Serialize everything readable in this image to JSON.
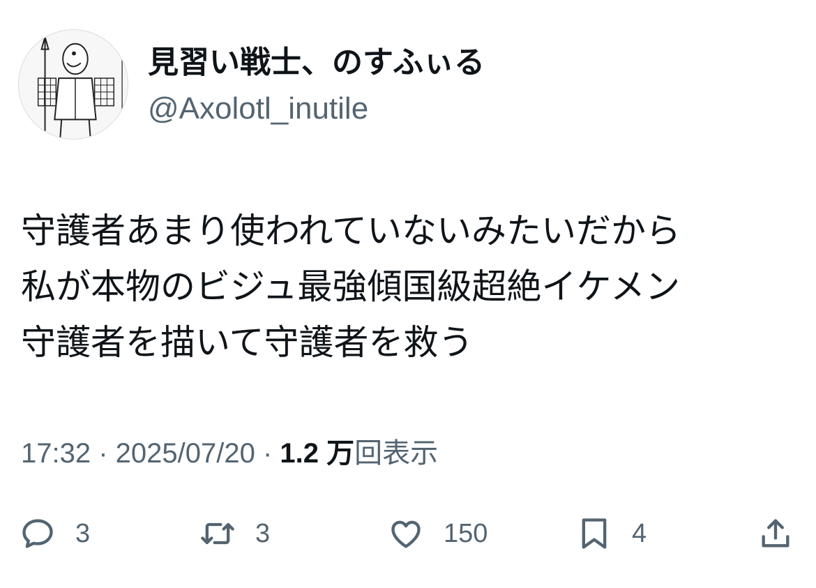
{
  "author": {
    "display_name": "見習い戦士、のすふぃる",
    "handle": "@Axolotl_inutile"
  },
  "tweet": {
    "lines": [
      "守護者あまり使われていないみたいだから",
      "私が本物のビジュ最強傾国級超絶イケメン",
      "守護者を描いて守護者を救う"
    ]
  },
  "meta": {
    "time": "17:32",
    "separator1": " · ",
    "date": "2025/07/20",
    "separator2": " · ",
    "views_count": "1.2 万",
    "views_label": "回表示"
  },
  "actions": {
    "reply": {
      "icon": "reply-icon",
      "count": "3"
    },
    "repost": {
      "icon": "repost-icon",
      "count": "3"
    },
    "like": {
      "icon": "heart-icon",
      "count": "150"
    },
    "bookmark": {
      "icon": "bookmark-icon",
      "count": "4"
    },
    "share": {
      "icon": "share-icon"
    }
  },
  "colors": {
    "text": "#0f1419",
    "secondary": "#536471",
    "background": "#ffffff"
  }
}
